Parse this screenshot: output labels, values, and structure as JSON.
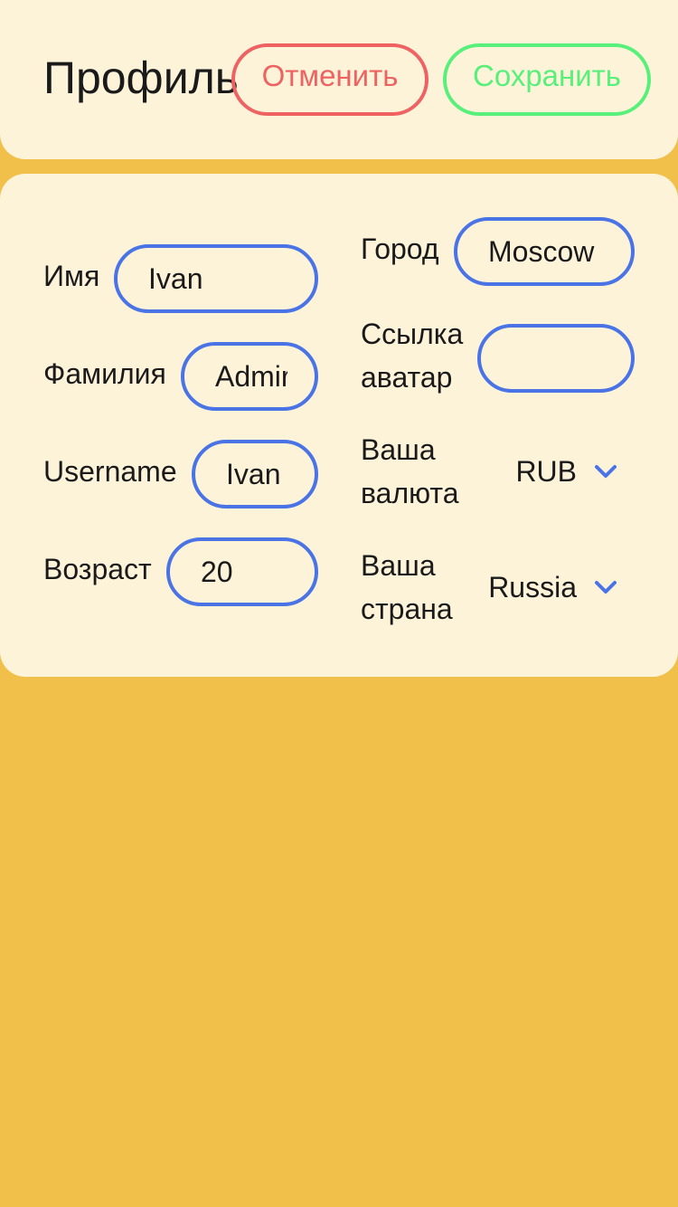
{
  "header": {
    "title": "Профиль",
    "cancel_label": "Отменить",
    "save_label": "Сохранить"
  },
  "form": {
    "first_name": {
      "label": "Имя",
      "value": "Ivan"
    },
    "last_name": {
      "label": "Фамилия",
      "value": "Admir"
    },
    "username": {
      "label": "Username",
      "value": "Ivan"
    },
    "age": {
      "label": "Возраст",
      "value": "20"
    },
    "city": {
      "label": "Город",
      "value": "Moscow"
    },
    "avatar": {
      "label_line1": "Ссылка",
      "label_line2": "аватар",
      "value": ""
    },
    "currency": {
      "label_line1": "Ваша",
      "label_line2": "валюта",
      "value": "RUB",
      "icon": "chevron-down-icon"
    },
    "country": {
      "label_line1": "Ваша",
      "label_line2": "страна",
      "value": "Russia",
      "icon": "chevron-down-icon"
    }
  },
  "colors": {
    "background": "#f0c04a",
    "card": "#fdf3d9",
    "cancel": "#ef6262",
    "save": "#58f07a",
    "field_border": "#4a74e6"
  }
}
